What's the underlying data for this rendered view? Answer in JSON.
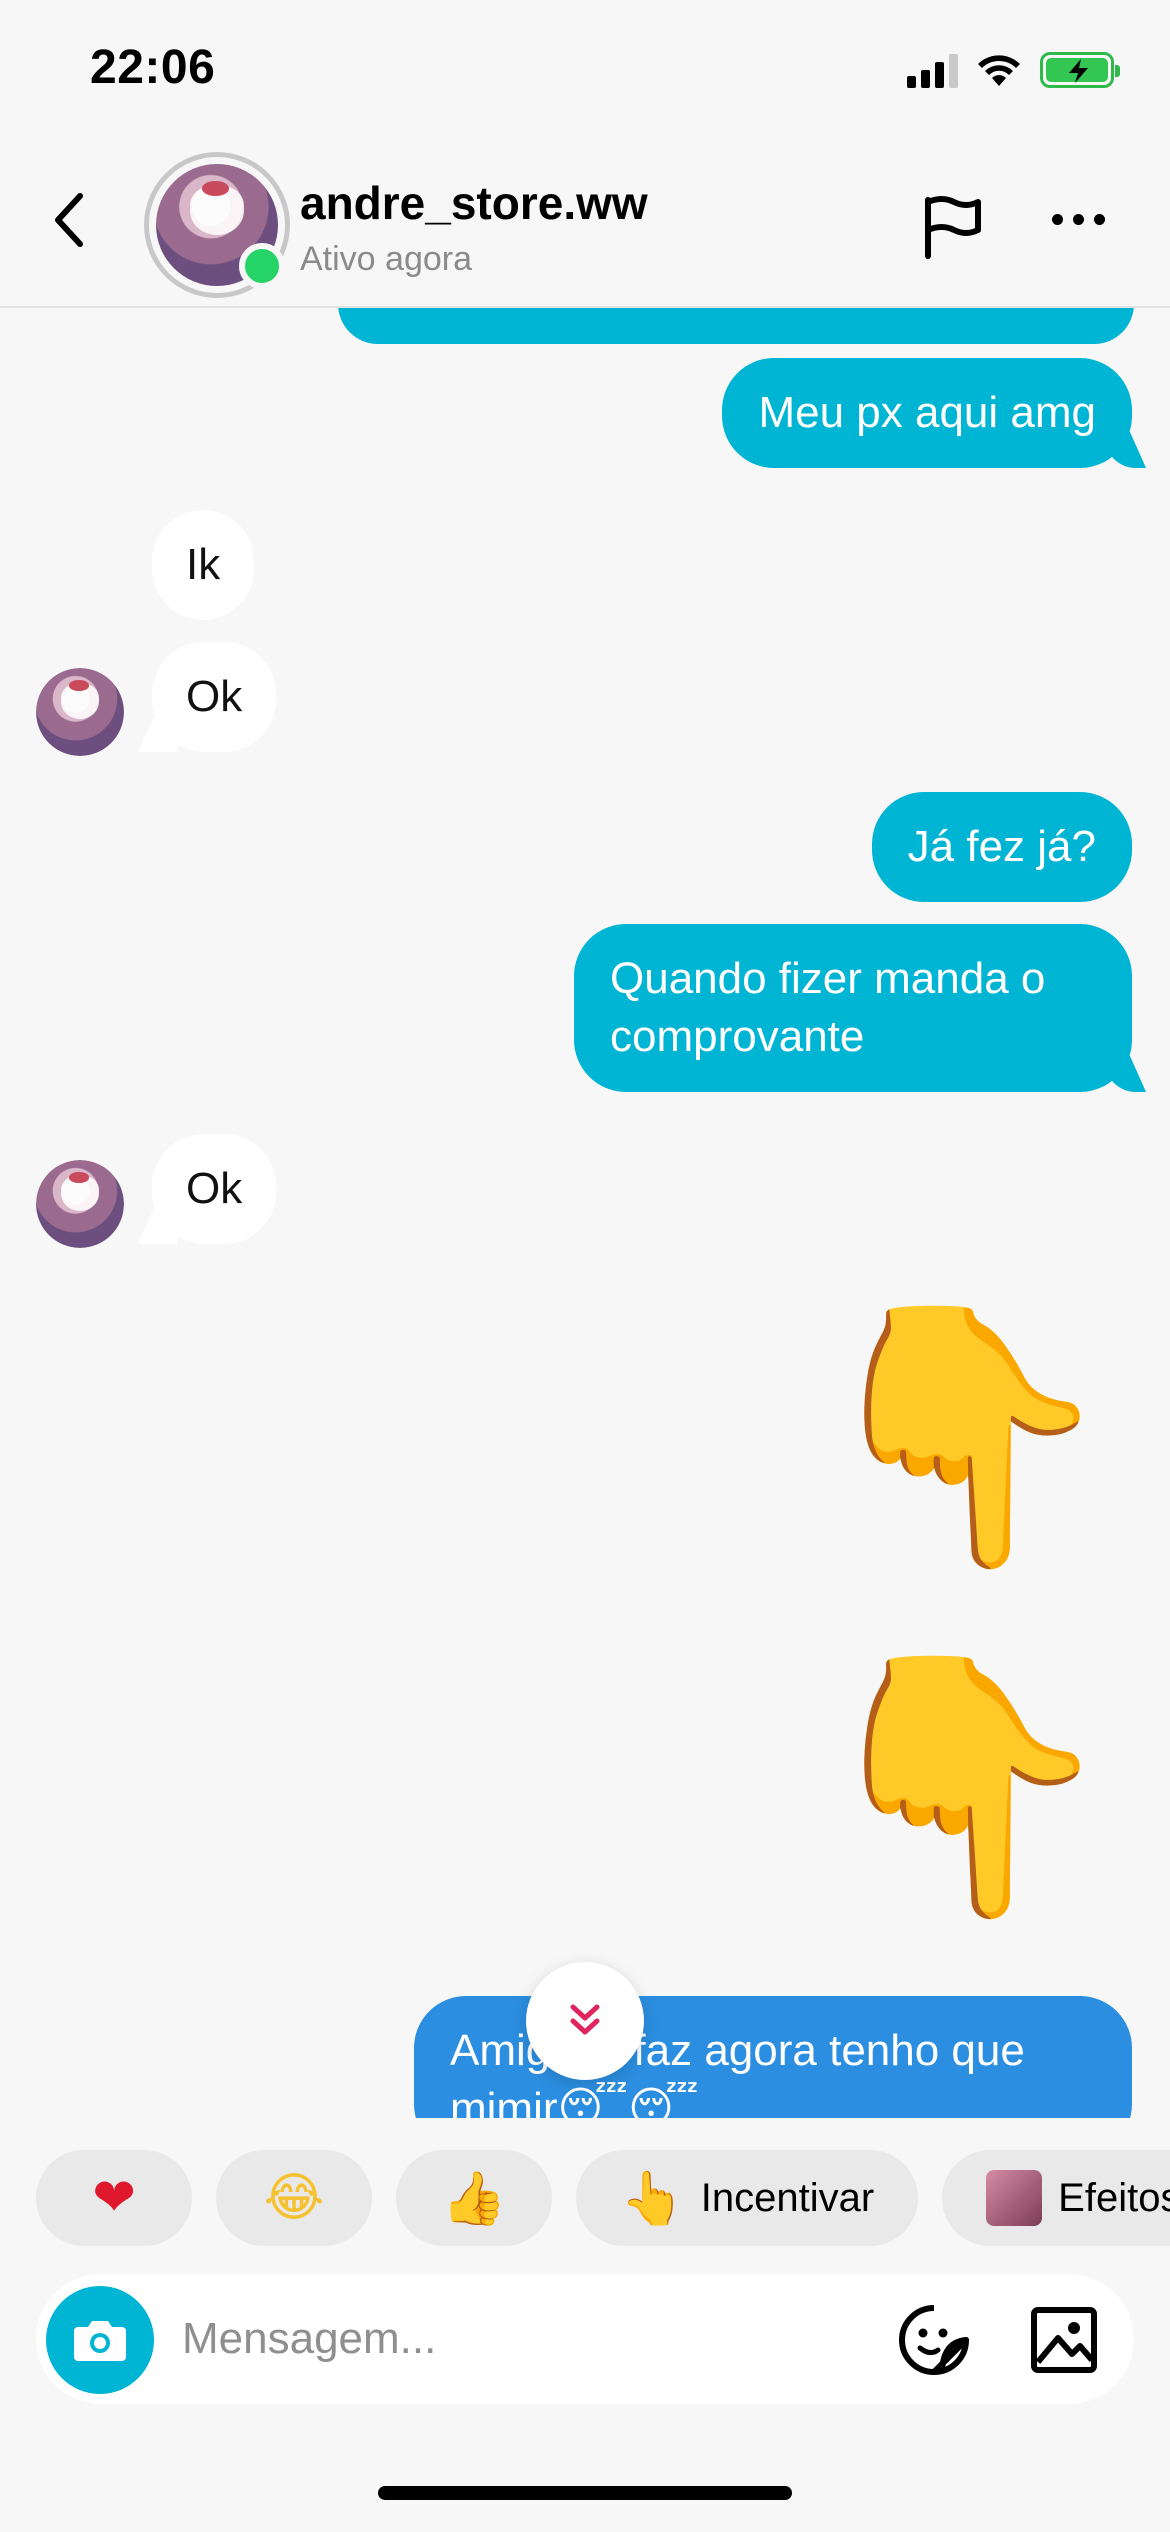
{
  "status_bar": {
    "time": "22:06"
  },
  "header": {
    "username": "andre_store.ww",
    "status": "Ativo agora"
  },
  "messages": [
    {
      "id": "m0",
      "direction": "out",
      "text": ""
    },
    {
      "id": "m1",
      "direction": "out",
      "text": "Meu px aqui amg"
    },
    {
      "id": "m2",
      "direction": "in",
      "text": "Ik"
    },
    {
      "id": "m3",
      "direction": "in",
      "text": "Ok"
    },
    {
      "id": "m4",
      "direction": "out",
      "text": "Já fez já?"
    },
    {
      "id": "m5",
      "direction": "out",
      "text": "Quando fizer manda o comprovante"
    },
    {
      "id": "m6",
      "direction": "in",
      "text": "Ok"
    },
    {
      "id": "m7",
      "direction": "out",
      "text": "👇"
    },
    {
      "id": "m8",
      "direction": "out",
      "text": "👇"
    },
    {
      "id": "m9",
      "direction": "out",
      "text": "Amigo já faz agora tenho que mimir😴😴"
    }
  ],
  "quick_replies": [
    {
      "emoji": "❤",
      "label": ""
    },
    {
      "emoji": "😂",
      "label": ""
    },
    {
      "emoji": "👍",
      "label": ""
    },
    {
      "emoji": "👆",
      "label": "Incentivar"
    },
    {
      "emoji": "",
      "label": "Efeitos"
    }
  ],
  "composer": {
    "placeholder": "Mensagem..."
  },
  "colors": {
    "outgoing_bubble": "#00b4d4",
    "incoming_bubble": "#ffffff",
    "online": "#25d366",
    "background": "#f7f7f7"
  },
  "icons": {
    "back": "chevron-left-icon",
    "report": "flag-icon",
    "more": "more-horizontal-icon",
    "scroll": "double-chevron-down-icon",
    "camera": "camera-icon",
    "sticker": "sticker-icon",
    "gallery": "image-icon"
  }
}
